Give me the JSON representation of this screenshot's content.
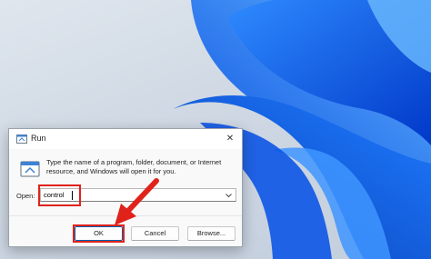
{
  "window": {
    "title": "Run",
    "close_glyph": "✕"
  },
  "dialog": {
    "description": "Type the name of a program, folder, document, or Internet resource, and Windows will open it for you.",
    "open_label": "Open:",
    "open_value": "control",
    "buttons": {
      "ok": "OK",
      "cancel": "Cancel",
      "browse": "Browse..."
    }
  },
  "icons": {
    "title": "run-icon",
    "main": "run-icon",
    "dropdown": "chevron-down-icon"
  },
  "colors": {
    "highlight": "#e0221b",
    "wallpaper_blue": "#0a5cf0"
  }
}
